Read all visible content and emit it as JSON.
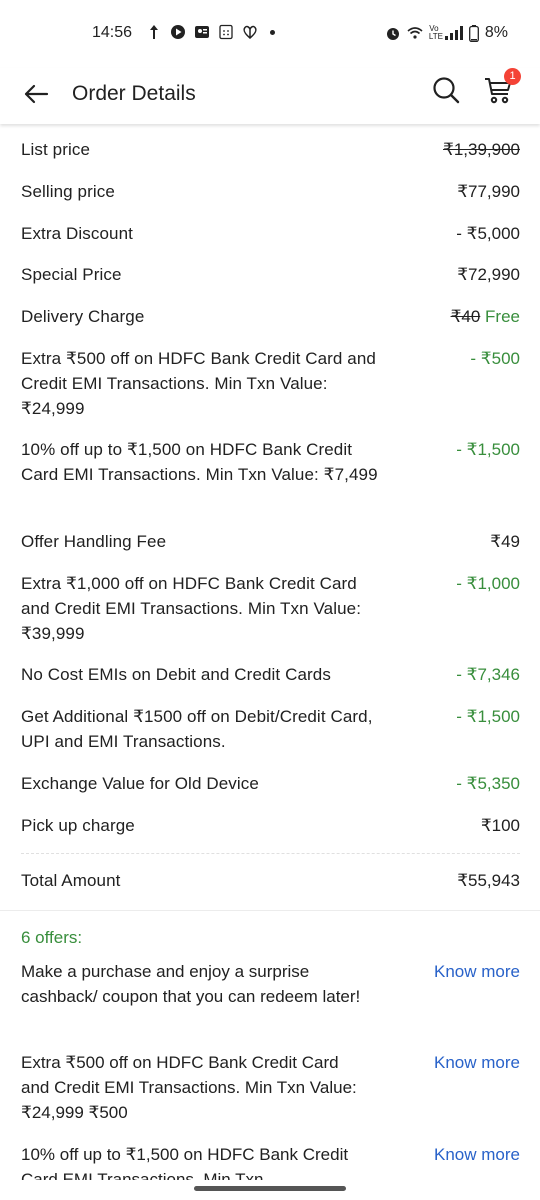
{
  "status_bar": {
    "time": "14:56",
    "battery": "8%",
    "network": "VoLTE"
  },
  "app_bar": {
    "title": "Order Details",
    "cart_count": "1"
  },
  "price_rows": [
    {
      "label": "List price",
      "value": "₹1,39,900"
    },
    {
      "label": "Selling price",
      "value": "₹77,990"
    },
    {
      "label": "Extra Discount",
      "value": "- ₹5,000"
    },
    {
      "label": "Special Price",
      "value": "₹72,990"
    },
    {
      "label": "Delivery Charge",
      "value_strike": "₹40",
      "value": "Free"
    },
    {
      "label": "Extra ₹500 off on HDFC Bank Credit Card and Credit EMI Transactions. Min Txn Value: ₹24,999",
      "value": "- ₹500"
    },
    {
      "label": "10% off up to ₹1,500 on HDFC Bank Credit Card EMI Transactions. Min Txn Value: ₹7,499",
      "value": "- ₹1,500"
    },
    {
      "label": "Offer Handling Fee",
      "value": "₹49"
    },
    {
      "label": "Extra ₹1,000 off on HDFC Bank Credit Card and Credit EMI Transactions. Min Txn Value: ₹39,999",
      "value": "- ₹1,000"
    },
    {
      "label": "No Cost EMIs on Debit and Credit Cards",
      "value": "- ₹7,346"
    },
    {
      "label": "Get Additional ₹1500 off on Debit/Credit Card, UPI and EMI Transactions.",
      "value": "- ₹1,500"
    },
    {
      "label": "Exchange Value for Old Device",
      "value": "- ₹5,350"
    },
    {
      "label": "Pick up charge",
      "value": "₹100"
    }
  ],
  "total": {
    "label": "Total Amount",
    "value": "₹55,943"
  },
  "offers": {
    "title": "6 offers:",
    "items": [
      {
        "text": "Make a purchase and enjoy a surprise cashback/ coupon that you can redeem later!",
        "link": "Know more"
      },
      {
        "text": "Extra ₹500 off on HDFC Bank Credit Card and Credit EMI Transactions. Min Txn Value: ₹24,999 ₹500",
        "link": "Know more"
      },
      {
        "text": "10% off up to ₹1,500 on HDFC Bank Credit Card EMI Transactions. Min Txn",
        "link": "Know more"
      }
    ]
  },
  "colors": {
    "green": "#388e3c",
    "link": "#2962c9",
    "badge": "#f44336"
  }
}
